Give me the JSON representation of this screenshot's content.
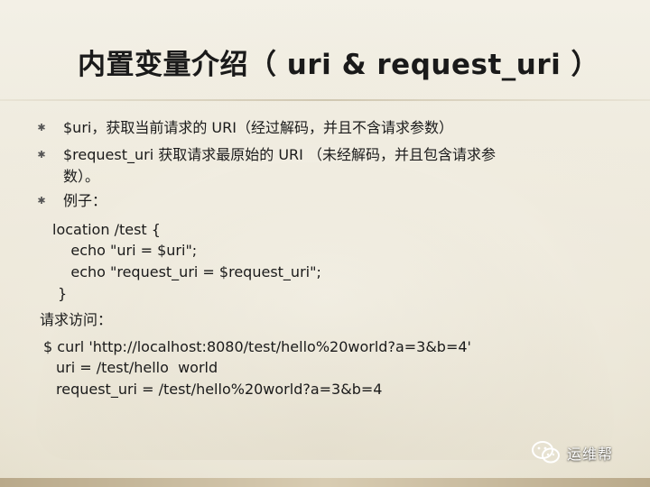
{
  "title": "内置变量介绍（ uri & request_uri ）",
  "bullets": [
    {
      "marker": "✱",
      "text": "$uri，获取当前请求的 URI（经过解码，并且不含请求参数）"
    },
    {
      "marker": "✱",
      "text_line1": "$request_uri 获取请求最原始的 URI （未经解码，并且包含请求参",
      "text_line2": "数）。"
    },
    {
      "marker": "✱",
      "text": "例子："
    }
  ],
  "example_code": [
    "location /test {",
    "    echo \"uri = $uri\";",
    "    echo \"request_uri = $request_uri\";",
    "}"
  ],
  "request_heading": "请求访问：",
  "request_output": [
    "$ curl 'http://localhost:8080/test/hello%20world?a=3&b=4'",
    "uri = /test/hello  world",
    "request_uri = /test/hello%20world?a=3&b=4"
  ],
  "watermark": {
    "text": "运维帮",
    "icon": "wechat-icon"
  }
}
